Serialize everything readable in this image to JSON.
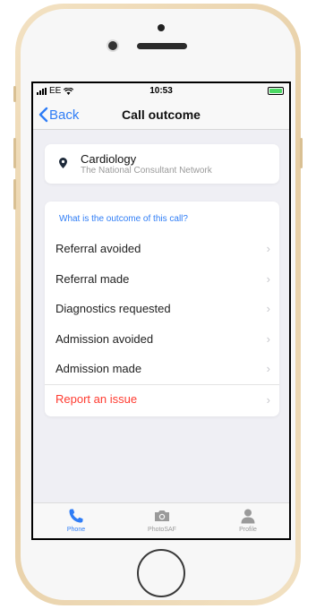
{
  "status_bar": {
    "carrier": "EE",
    "time": "10:53"
  },
  "nav": {
    "back_label": "Back",
    "title": "Call outcome"
  },
  "specialty": {
    "name": "Cardiology",
    "network": "The National Consultant Network"
  },
  "outcome": {
    "question": "What is the outcome of this call?",
    "options": [
      {
        "label": "Referral avoided"
      },
      {
        "label": "Referral made"
      },
      {
        "label": "Diagnostics requested"
      },
      {
        "label": "Admission avoided"
      },
      {
        "label": "Admission made"
      }
    ],
    "report_label": "Report an issue"
  },
  "tabs": [
    {
      "label": "Phone",
      "icon": "phone-icon",
      "active": true
    },
    {
      "label": "PhotoSAF",
      "icon": "camera-icon",
      "active": false
    },
    {
      "label": "Profile",
      "icon": "profile-icon",
      "active": false
    }
  ],
  "colors": {
    "accent": "#2f7df6",
    "danger": "#ff3b30",
    "inactive_tab": "#9a9a9a",
    "background": "#efeff4"
  }
}
